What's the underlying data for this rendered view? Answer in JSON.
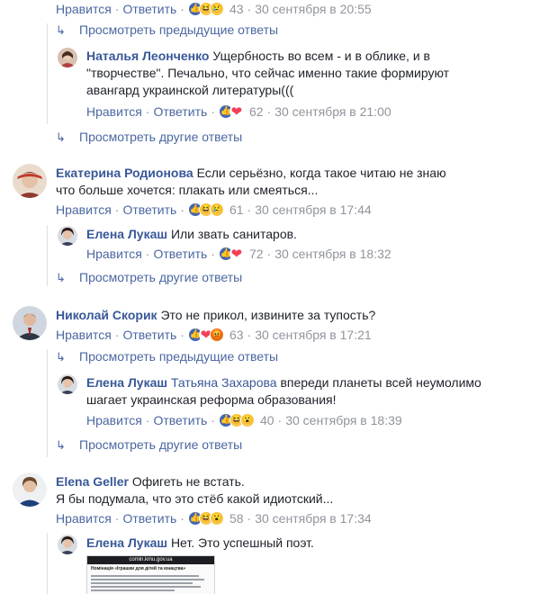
{
  "labels": {
    "like": "Нравится",
    "reply": "Ответить"
  },
  "threads": [
    {
      "meta": {
        "count": "43",
        "time": "30 сентября в 20:55",
        "reactions": [
          "like-icon",
          "haha-icon",
          "sad-icon"
        ]
      },
      "view_link": "Просмотреть предыдущие ответы",
      "reply": {
        "author": "Наталья Леонченко",
        "text": "Ущербность во всем - и в облике, и в \"творчестве\". Печально, что сейчас именно такие формируют авангард украинской литературы(((",
        "meta": {
          "count": "62",
          "time": "30 сентября в 21:00",
          "reactions": [
            "like-icon",
            "love-icon"
          ]
        }
      },
      "more_link": "Просмотреть другие ответы"
    },
    {
      "author": "Екатерина Родионова",
      "text": "Если серьёзно, когда такое читаю не знаю что больше хочется: плакать или смеяться...",
      "meta": {
        "count": "61",
        "time": "30 сентября в 17:44",
        "reactions": [
          "like-icon",
          "haha-icon",
          "sad-icon"
        ]
      },
      "reply": {
        "author": "Елена Лукаш",
        "text": "Или звать санитаров.",
        "meta": {
          "count": "72",
          "time": "30 сентября в 18:32",
          "reactions": [
            "like-icon",
            "love-icon"
          ]
        }
      },
      "more_link": "Просмотреть другие ответы"
    },
    {
      "author": "Николай Скорик",
      "text": "Это не прикол, извините за тупость?",
      "meta": {
        "count": "63",
        "time": "30 сентября в 17:21",
        "reactions": [
          "like-icon",
          "love-icon",
          "angry-icon"
        ]
      },
      "view_link": "Просмотреть предыдущие ответы",
      "reply": {
        "author": "Елена Лукаш",
        "tagged": "Татьяна Захарова",
        "text": "впереди планеты всей неумолимо шагает украинская реформа образования!",
        "meta": {
          "count": "40",
          "time": "30 сентября в 18:39",
          "reactions": [
            "like-icon",
            "haha-icon",
            "wow-icon"
          ]
        }
      },
      "more_link": "Просмотреть другие ответы"
    },
    {
      "author": "Elena Geller",
      "text_line1": "Офигеть не встать.",
      "text_line2": "Я бы подумала, что это стёб какой идиотский...",
      "meta": {
        "count": "58",
        "time": "30 сентября в 17:34",
        "reactions": [
          "like-icon",
          "haha-icon",
          "wow-icon"
        ]
      },
      "reply": {
        "author": "Елена Лукаш",
        "text": "Нет. Это успешный поэт.",
        "attachment": {
          "header": "comin.kmu.gov.ua",
          "title": "Номінація «Іграшки для дітей та юнацтва»"
        }
      }
    }
  ]
}
